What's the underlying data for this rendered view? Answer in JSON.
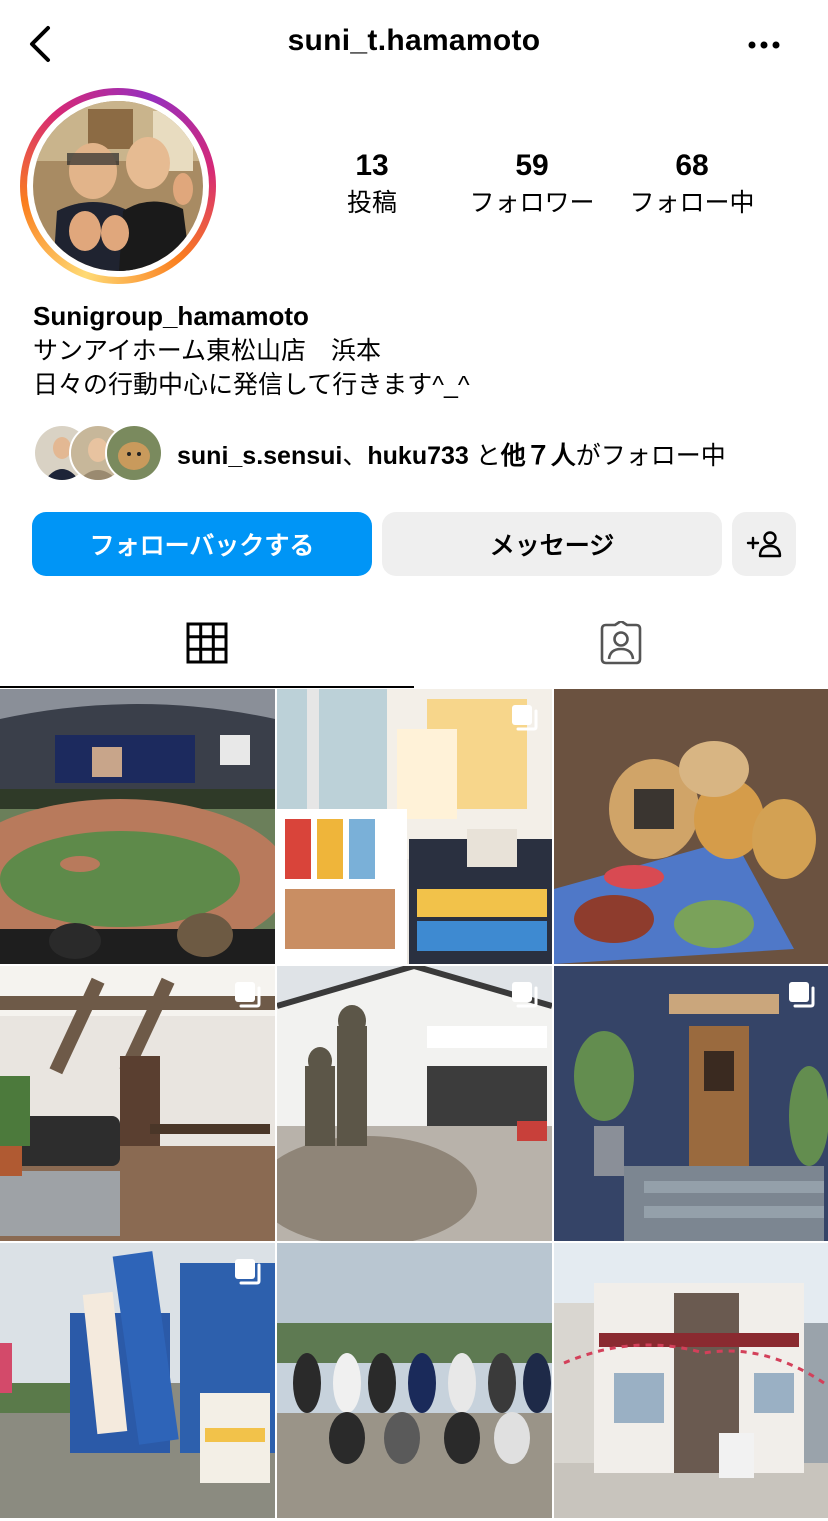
{
  "header": {
    "username": "suni_t.hamamoto"
  },
  "stats": [
    {
      "value": "13",
      "label": "投稿"
    },
    {
      "value": "59",
      "label": "フォロワー"
    },
    {
      "value": "68",
      "label": "フォロー中"
    }
  ],
  "bio": {
    "display_name": "Sunigroup_hamamoto",
    "line1": "サンアイホーム東松山店　浜本",
    "line2": "日々の行動中心に発信して行きます^_^"
  },
  "followed_by": {
    "user1": "suni_s.sensui",
    "sep": "、",
    "user2": "huku733",
    "mid": " と",
    "others": "他７人",
    "suffix": "がフォロー中"
  },
  "actions": {
    "follow_back": "フォローバックする",
    "message": "メッセージ"
  },
  "colors": {
    "primary": "#0095f6",
    "secondary_btn": "#efefef"
  },
  "icons": {
    "back": "chevron-left-icon",
    "more": "more-horizontal-icon",
    "add_person": "add-person-icon",
    "grid": "grid-icon",
    "tagged": "tagged-icon",
    "multi": "multiple-photos-icon"
  }
}
